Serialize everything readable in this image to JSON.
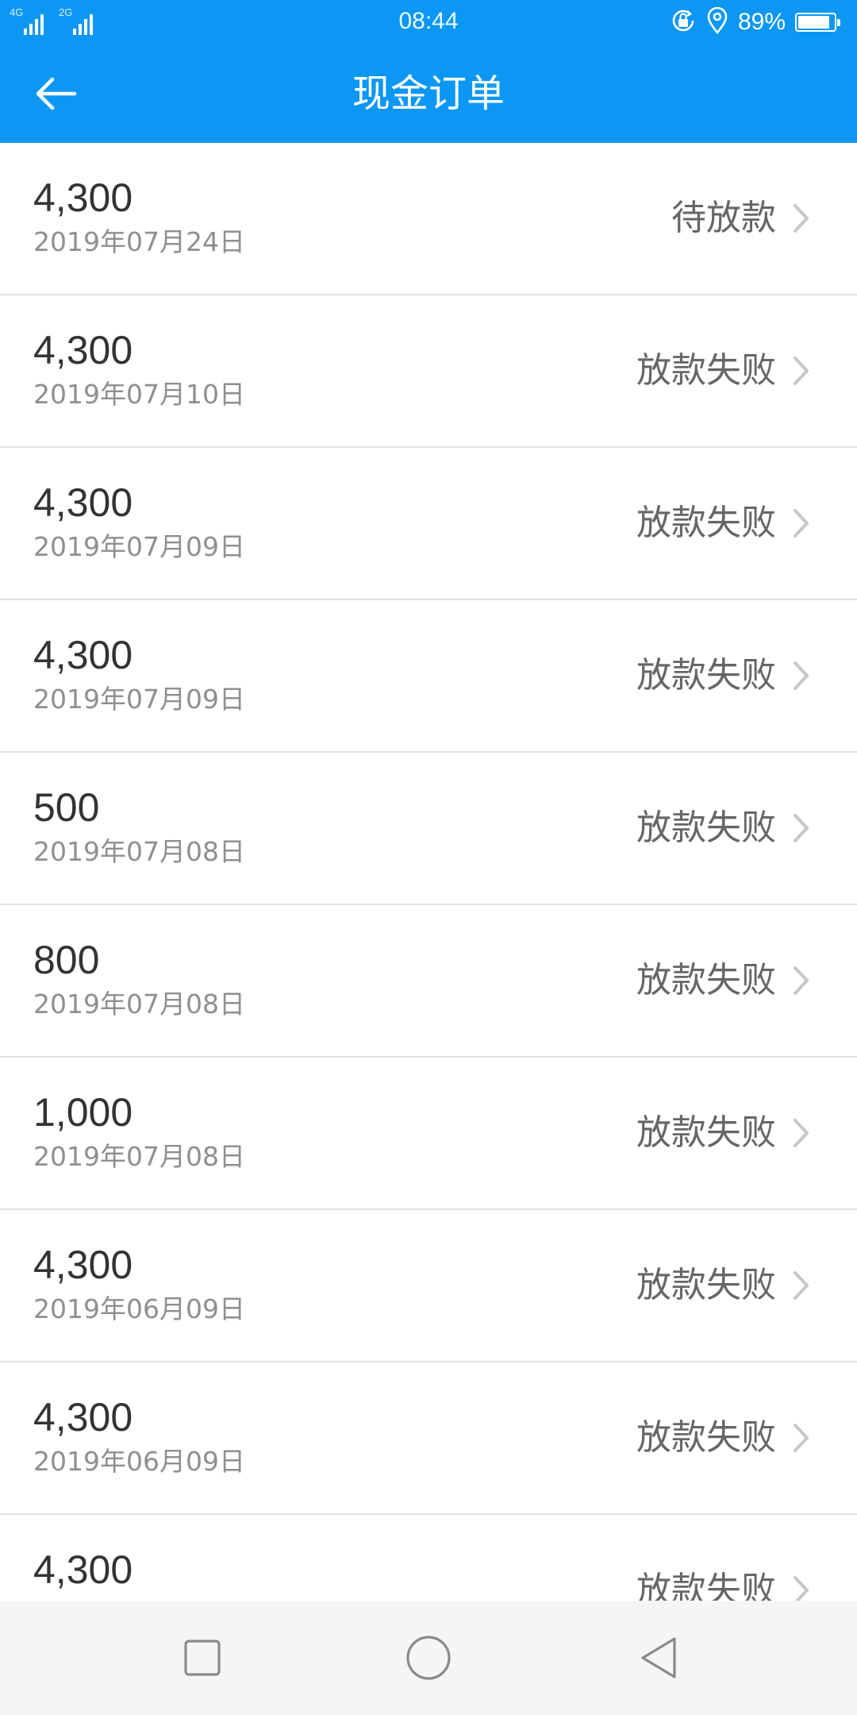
{
  "status_bar": {
    "network_1": "4G",
    "network_2": "2G",
    "time": "08:44",
    "battery_percent": "89%",
    "battery_level": 0.89,
    "icons": [
      "lock-rotation-icon",
      "location-icon",
      "battery-icon"
    ]
  },
  "header": {
    "title": "现金订单",
    "back_icon": "arrow-left-icon",
    "background": "#0b97f3"
  },
  "orders": [
    {
      "amount": "4,300",
      "date": "2019年07月24日",
      "status": "待放款"
    },
    {
      "amount": "4,300",
      "date": "2019年07月10日",
      "status": "放款失败"
    },
    {
      "amount": "4,300",
      "date": "2019年07月09日",
      "status": "放款失败"
    },
    {
      "amount": "4,300",
      "date": "2019年07月09日",
      "status": "放款失败"
    },
    {
      "amount": "500",
      "date": "2019年07月08日",
      "status": "放款失败"
    },
    {
      "amount": "800",
      "date": "2019年07月08日",
      "status": "放款失败"
    },
    {
      "amount": "1,000",
      "date": "2019年07月08日",
      "status": "放款失败"
    },
    {
      "amount": "4,300",
      "date": "2019年06月09日",
      "status": "放款失败"
    },
    {
      "amount": "4,300",
      "date": "2019年06月09日",
      "status": "放款失败"
    },
    {
      "amount": "4,300",
      "date": "",
      "status": "放款失败"
    }
  ],
  "system_nav": {
    "icons": [
      "recents-square-icon",
      "home-circle-icon",
      "back-triangle-icon"
    ]
  }
}
